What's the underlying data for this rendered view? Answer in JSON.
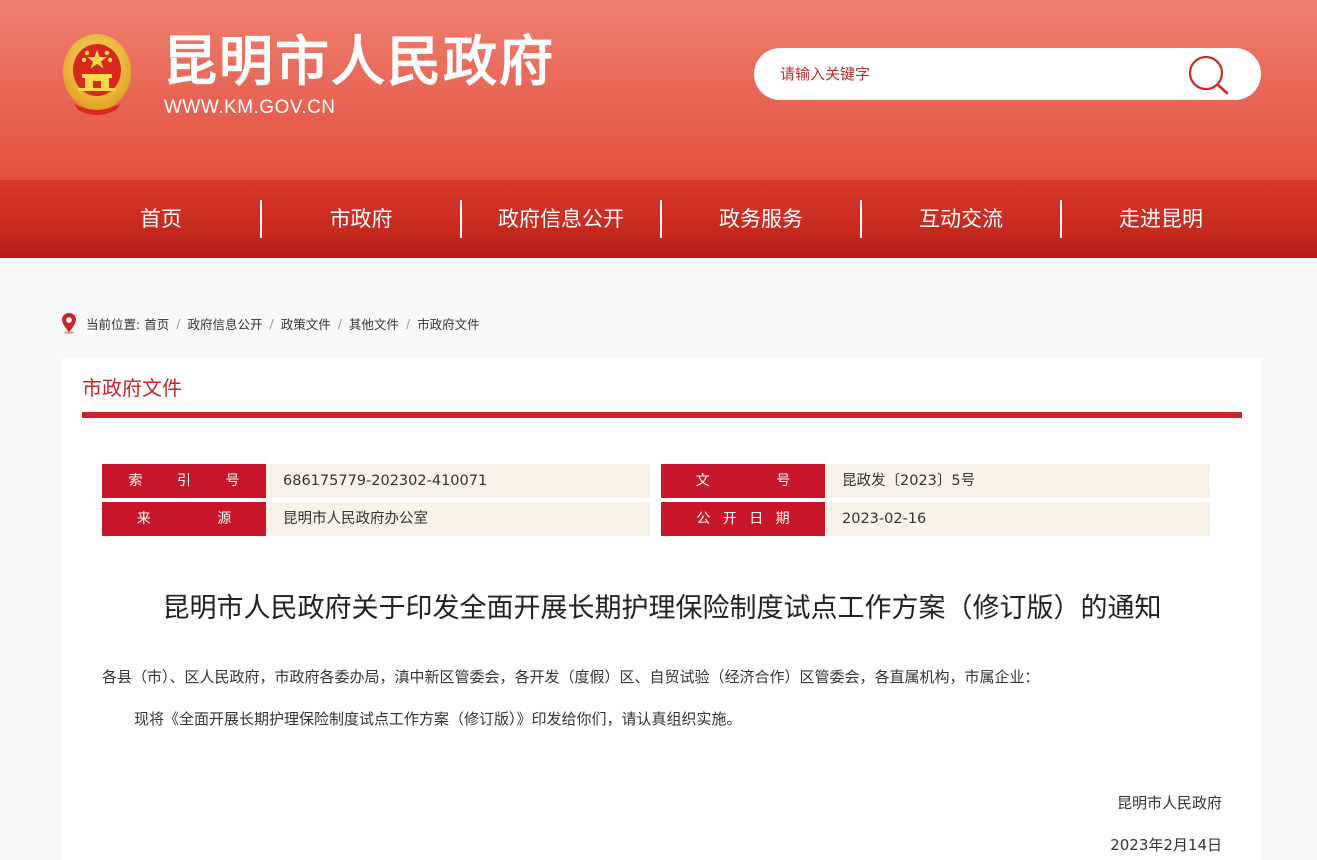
{
  "header": {
    "site_name": "昆明市人民政府",
    "site_url": "WWW.KM.GOV.CN",
    "search_placeholder": "请输入关键字"
  },
  "nav": {
    "items": [
      "首页",
      "市政府",
      "政府信息公开",
      "政务服务",
      "互动交流",
      "走进昆明"
    ]
  },
  "breadcrumb": {
    "label": "当前位置:",
    "items": [
      "首页",
      "政府信息公开",
      "政策文件",
      "其他文件",
      "市政府文件"
    ],
    "separator": "/"
  },
  "panel": {
    "title": "市政府文件",
    "meta": {
      "index_label": "索 引 号",
      "index_value": "686175779-202302-410071",
      "doc_no_label": "文 号",
      "doc_no_value": "昆政发〔2023〕5号",
      "source_label": "来 源",
      "source_value": "昆明市人民政府办公室",
      "date_label": "公 开 日 期",
      "date_value": "2023-02-16"
    },
    "doc_title": "昆明市人民政府关于印发全面开展长期护理保险制度试点工作方案（修订版）的通知",
    "recipients": "各县（市）、区人民政府，市政府各委办局，滇中新区管委会，各开发（度假）区、自贸试验（经济合作）区管委会，各直属机构，市属企业：",
    "body": "现将《全面开展长期护理保险制度试点工作方案（修订版）》印发给你们，请认真组织实施。",
    "signature": "昆明市人民政府",
    "sign_date": "2023年2月14日"
  },
  "colors": {
    "header_top": "#ed8070",
    "nav_red": "#c92a20",
    "accent_red": "#c8242a",
    "label_red": "#c8172a",
    "value_bg": "#f8f2e9"
  }
}
